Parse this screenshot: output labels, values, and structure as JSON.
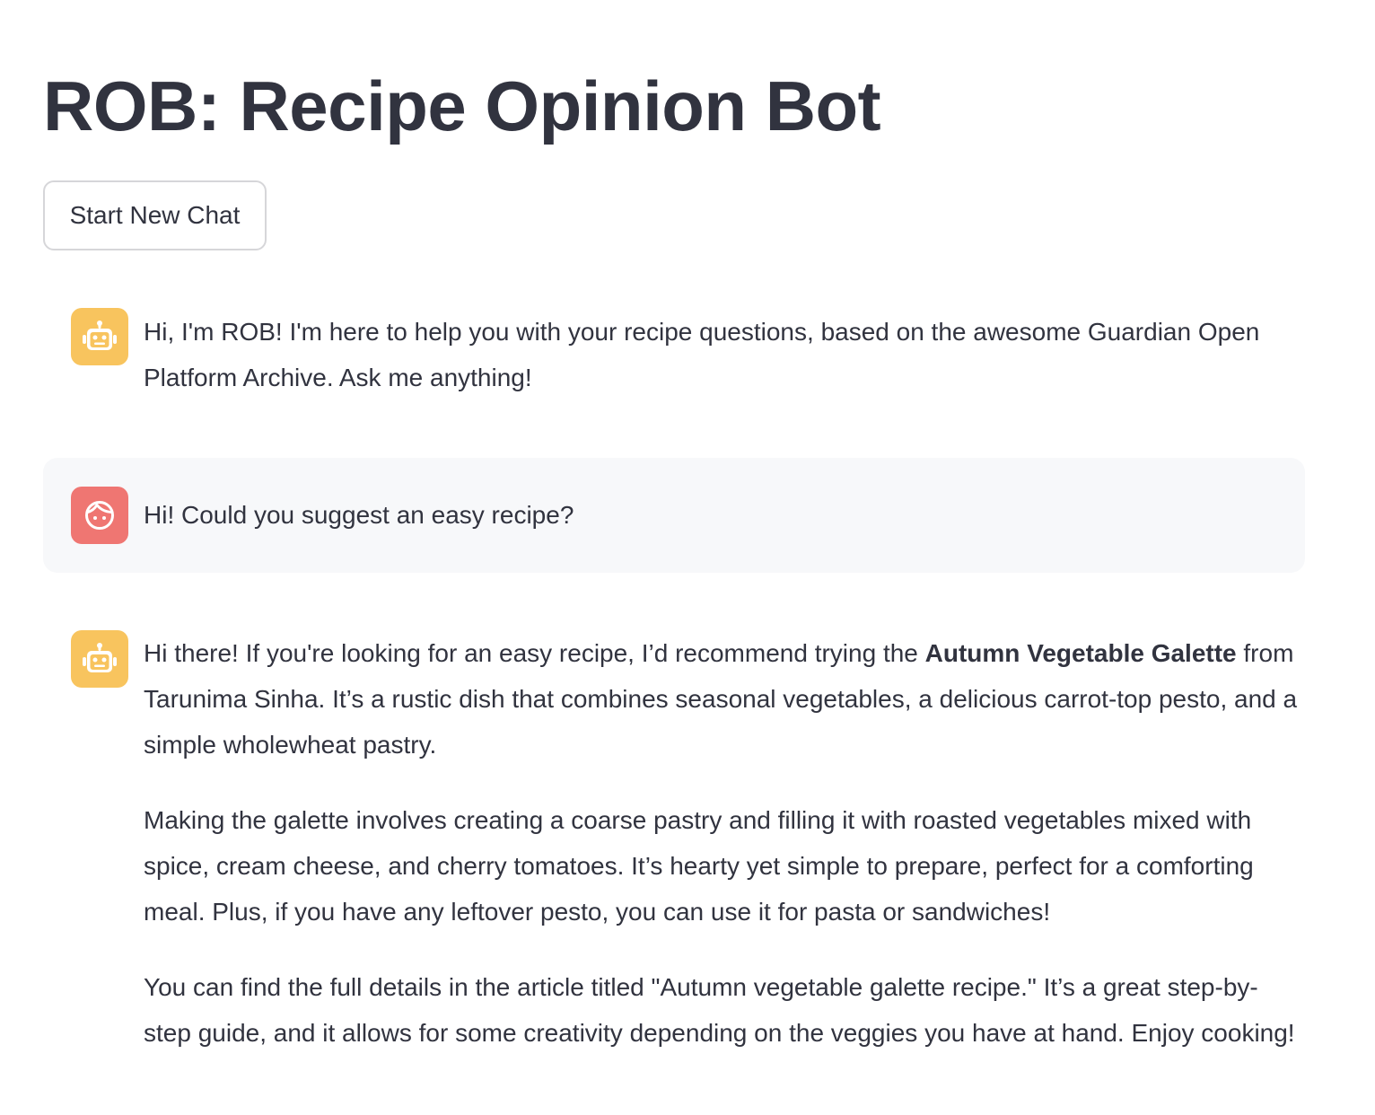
{
  "app": {
    "title": "ROB: Recipe Opinion Bot"
  },
  "toolbar": {
    "new_chat_label": "Start New Chat"
  },
  "messages": [
    {
      "role": "assistant",
      "avatar_icon": "robot-icon",
      "text": "Hi, I'm ROB! I'm here to help you with your recipe questions, based on the awesome Guardian Open Platform Archive. Ask me anything!"
    },
    {
      "role": "user",
      "avatar_icon": "user-face-icon",
      "text": "Hi! Could you suggest an easy recipe?"
    },
    {
      "role": "assistant",
      "avatar_icon": "robot-icon",
      "p1_before": "Hi there! If you're looking for an easy recipe, I’d recommend trying the ",
      "p1_bold": "Autumn Vegetable Galette",
      "p1_after": " from Tarunima Sinha. It’s a rustic dish that combines seasonal vegetables, a delicious carrot-top pesto, and a simple wholewheat pastry.",
      "p2": "Making the galette involves creating a coarse pastry and filling it with roasted vegetables mixed with spice, cream cheese, and cherry tomatoes. It’s hearty yet simple to prepare, perfect for a comforting meal. Plus, if you have any leftover pesto, you can use it for pasta or sandwiches!",
      "p3": "You can find the full details in the article titled \"Autumn vegetable galette recipe.\" It’s a great step-by-step guide, and it allows for some creativity depending on the veggies you have at hand. Enjoy cooking!"
    }
  ],
  "colors": {
    "text": "#31333f",
    "bot_avatar": "#f8c45e",
    "user_avatar": "#ef7672",
    "user_message_bg": "#f7f8fa",
    "button_border": "#d6d6d9"
  }
}
